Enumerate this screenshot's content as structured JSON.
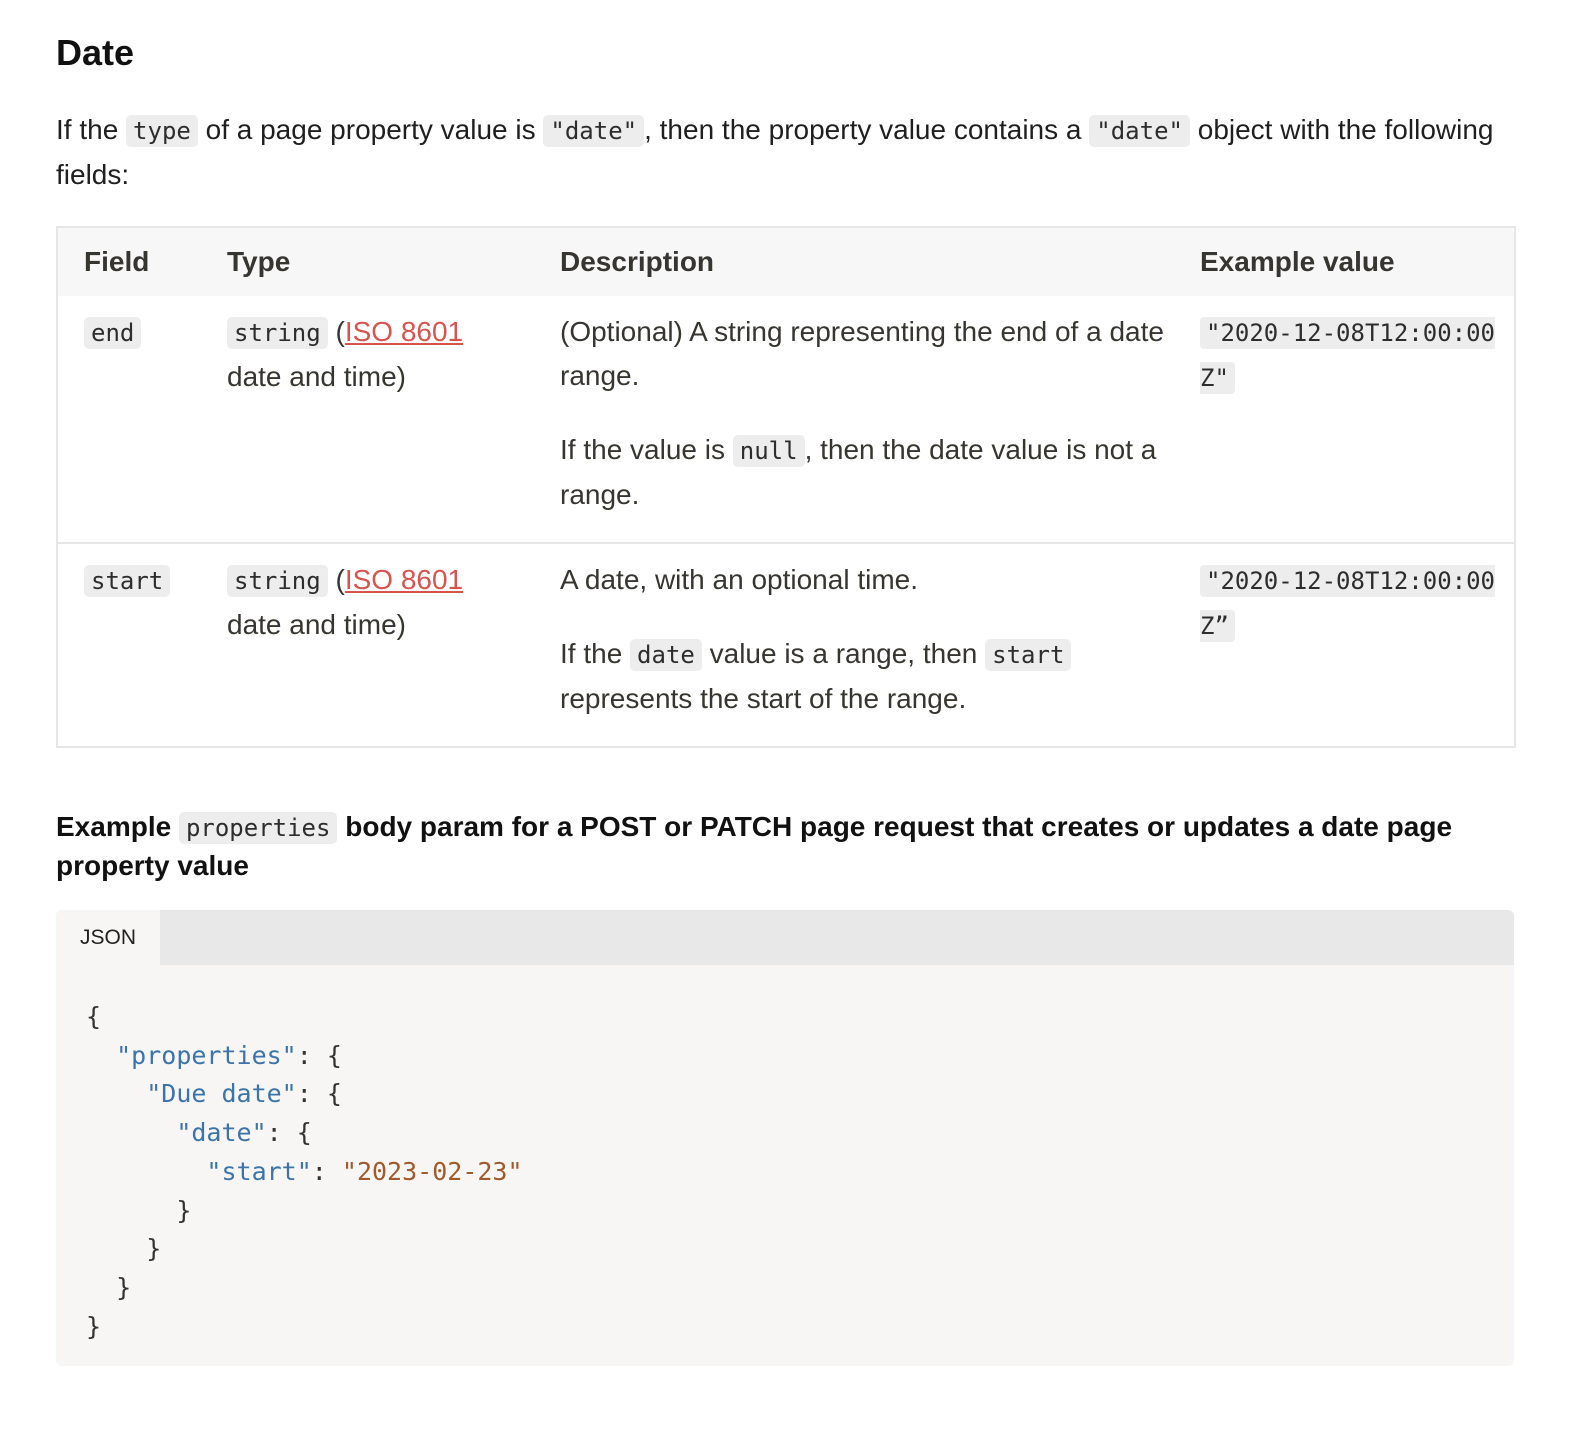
{
  "heading": "Date",
  "intro": {
    "t1": "If the ",
    "c1": "type",
    "t2": " of a page property value is ",
    "c2": "\"date\"",
    "t3": ", then the property value contains a ",
    "c3": "\"date\"",
    "t4": " object with the following fields:"
  },
  "table": {
    "headers": [
      "Field",
      "Type",
      "Description",
      "Example value"
    ],
    "rows": [
      {
        "field": "end",
        "type_code": "string",
        "type_open": " (",
        "type_link": "ISO 8601",
        "type_rest": " date and time)",
        "desc1": "(Optional) A string representing the end of a date range.",
        "desc2_a": "If the value is ",
        "desc2_code": "null",
        "desc2_b": ", then the date value is not a range.",
        "example": "\"2020-12-08T12:00:00Z\""
      },
      {
        "field": "start",
        "type_code": "string",
        "type_open": " (",
        "type_link": "ISO 8601",
        "type_rest": " date and time)",
        "desc1": "A date, with an optional time.",
        "desc2_a": "If the ",
        "desc2_code": "date",
        "desc2_b": " value is a range, then ",
        "desc2_code2": "start",
        "desc2_c": " represents the start of the range.",
        "example": "\"2020-12-08T12:00:00Z”"
      }
    ]
  },
  "example_heading": {
    "t1": "Example ",
    "code": "properties",
    "t2": " body param for a POST or PATCH page request that creates or updates a date page property value"
  },
  "codeblock": {
    "tab": "JSON",
    "lines": [
      {
        "indent": "",
        "pre": "{"
      },
      {
        "indent": "  ",
        "key": "\"properties\"",
        "post": ": {"
      },
      {
        "indent": "    ",
        "key": "\"Due date\"",
        "post": ": {"
      },
      {
        "indent": "      ",
        "key": "\"date\"",
        "post": ": {"
      },
      {
        "indent": "        ",
        "key": "\"start\"",
        "post": ": ",
        "str": "\"2023-02-23\""
      },
      {
        "indent": "      ",
        "pre": "}"
      },
      {
        "indent": "    ",
        "pre": "}"
      },
      {
        "indent": "  ",
        "pre": "}"
      },
      {
        "indent": "",
        "pre": "}"
      }
    ]
  }
}
